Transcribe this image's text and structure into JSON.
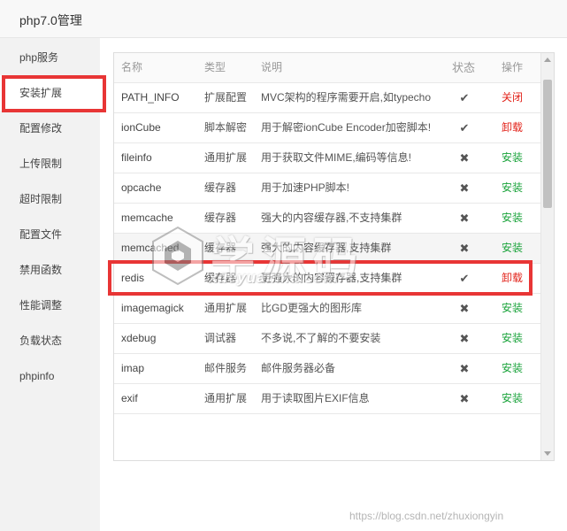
{
  "window": {
    "title": "php7.0管理"
  },
  "sidebar": {
    "items": [
      {
        "label": "php服务"
      },
      {
        "label": "安装扩展"
      },
      {
        "label": "配置修改"
      },
      {
        "label": "上传限制"
      },
      {
        "label": "超时限制"
      },
      {
        "label": "配置文件"
      },
      {
        "label": "禁用函数"
      },
      {
        "label": "性能调整"
      },
      {
        "label": "负载状态"
      },
      {
        "label": "phpinfo"
      }
    ],
    "active": "安装扩展"
  },
  "table": {
    "headers": {
      "name": "名称",
      "type": "类型",
      "desc": "说明",
      "status": "状态",
      "op": "操作"
    },
    "rows": [
      {
        "name": "PATH_INFO",
        "type": "扩展配置",
        "desc": "MVC架构的程序需要开启,如typecho",
        "status": "✔",
        "op": "关闭",
        "op_color": "red"
      },
      {
        "name": "ionCube",
        "type": "脚本解密",
        "desc": "用于解密ionCube Encoder加密脚本!",
        "status": "✔",
        "op": "卸载",
        "op_color": "red"
      },
      {
        "name": "fileinfo",
        "type": "通用扩展",
        "desc": "用于获取文件MIME,编码等信息!",
        "status": "✖",
        "op": "安装",
        "op_color": "green"
      },
      {
        "name": "opcache",
        "type": "缓存器",
        "desc": "用于加速PHP脚本!",
        "status": "✖",
        "op": "安装",
        "op_color": "green"
      },
      {
        "name": "memcache",
        "type": "缓存器",
        "desc": "强大的内容缓存器,不支持集群",
        "status": "✖",
        "op": "安装",
        "op_color": "green"
      },
      {
        "name": "memcached",
        "type": "缓存器",
        "desc": "强大的内容缓存器,支持集群",
        "status": "✖",
        "op": "安装",
        "op_color": "green"
      },
      {
        "name": "redis",
        "type": "缓存器",
        "desc": "更强大的内容缓存器,支持集群",
        "status": "✔",
        "op": "卸载",
        "op_color": "red"
      },
      {
        "name": "imagemagick",
        "type": "通用扩展",
        "desc": "比GD更强大的图形库",
        "status": "✖",
        "op": "安装",
        "op_color": "green"
      },
      {
        "name": "xdebug",
        "type": "调试器",
        "desc": "不多说,不了解的不要安装",
        "status": "✖",
        "op": "安装",
        "op_color": "green"
      },
      {
        "name": "imap",
        "type": "邮件服务",
        "desc": "邮件服务器必备",
        "status": "✖",
        "op": "安装",
        "op_color": "green"
      },
      {
        "name": "exif",
        "type": "通用扩展",
        "desc": "用于读取图片EXIF信息",
        "status": "✖",
        "op": "安装",
        "op_color": "green"
      }
    ]
  },
  "watermark": {
    "text": "学源码",
    "subtext": "xueyuanma.com"
  },
  "footer_watermark": "https://blog.csdn.net/zhuxiongyin",
  "colors": {
    "highlight_box": "#e83535",
    "op_red": "#e2231a",
    "op_green": "#1aa33b"
  }
}
